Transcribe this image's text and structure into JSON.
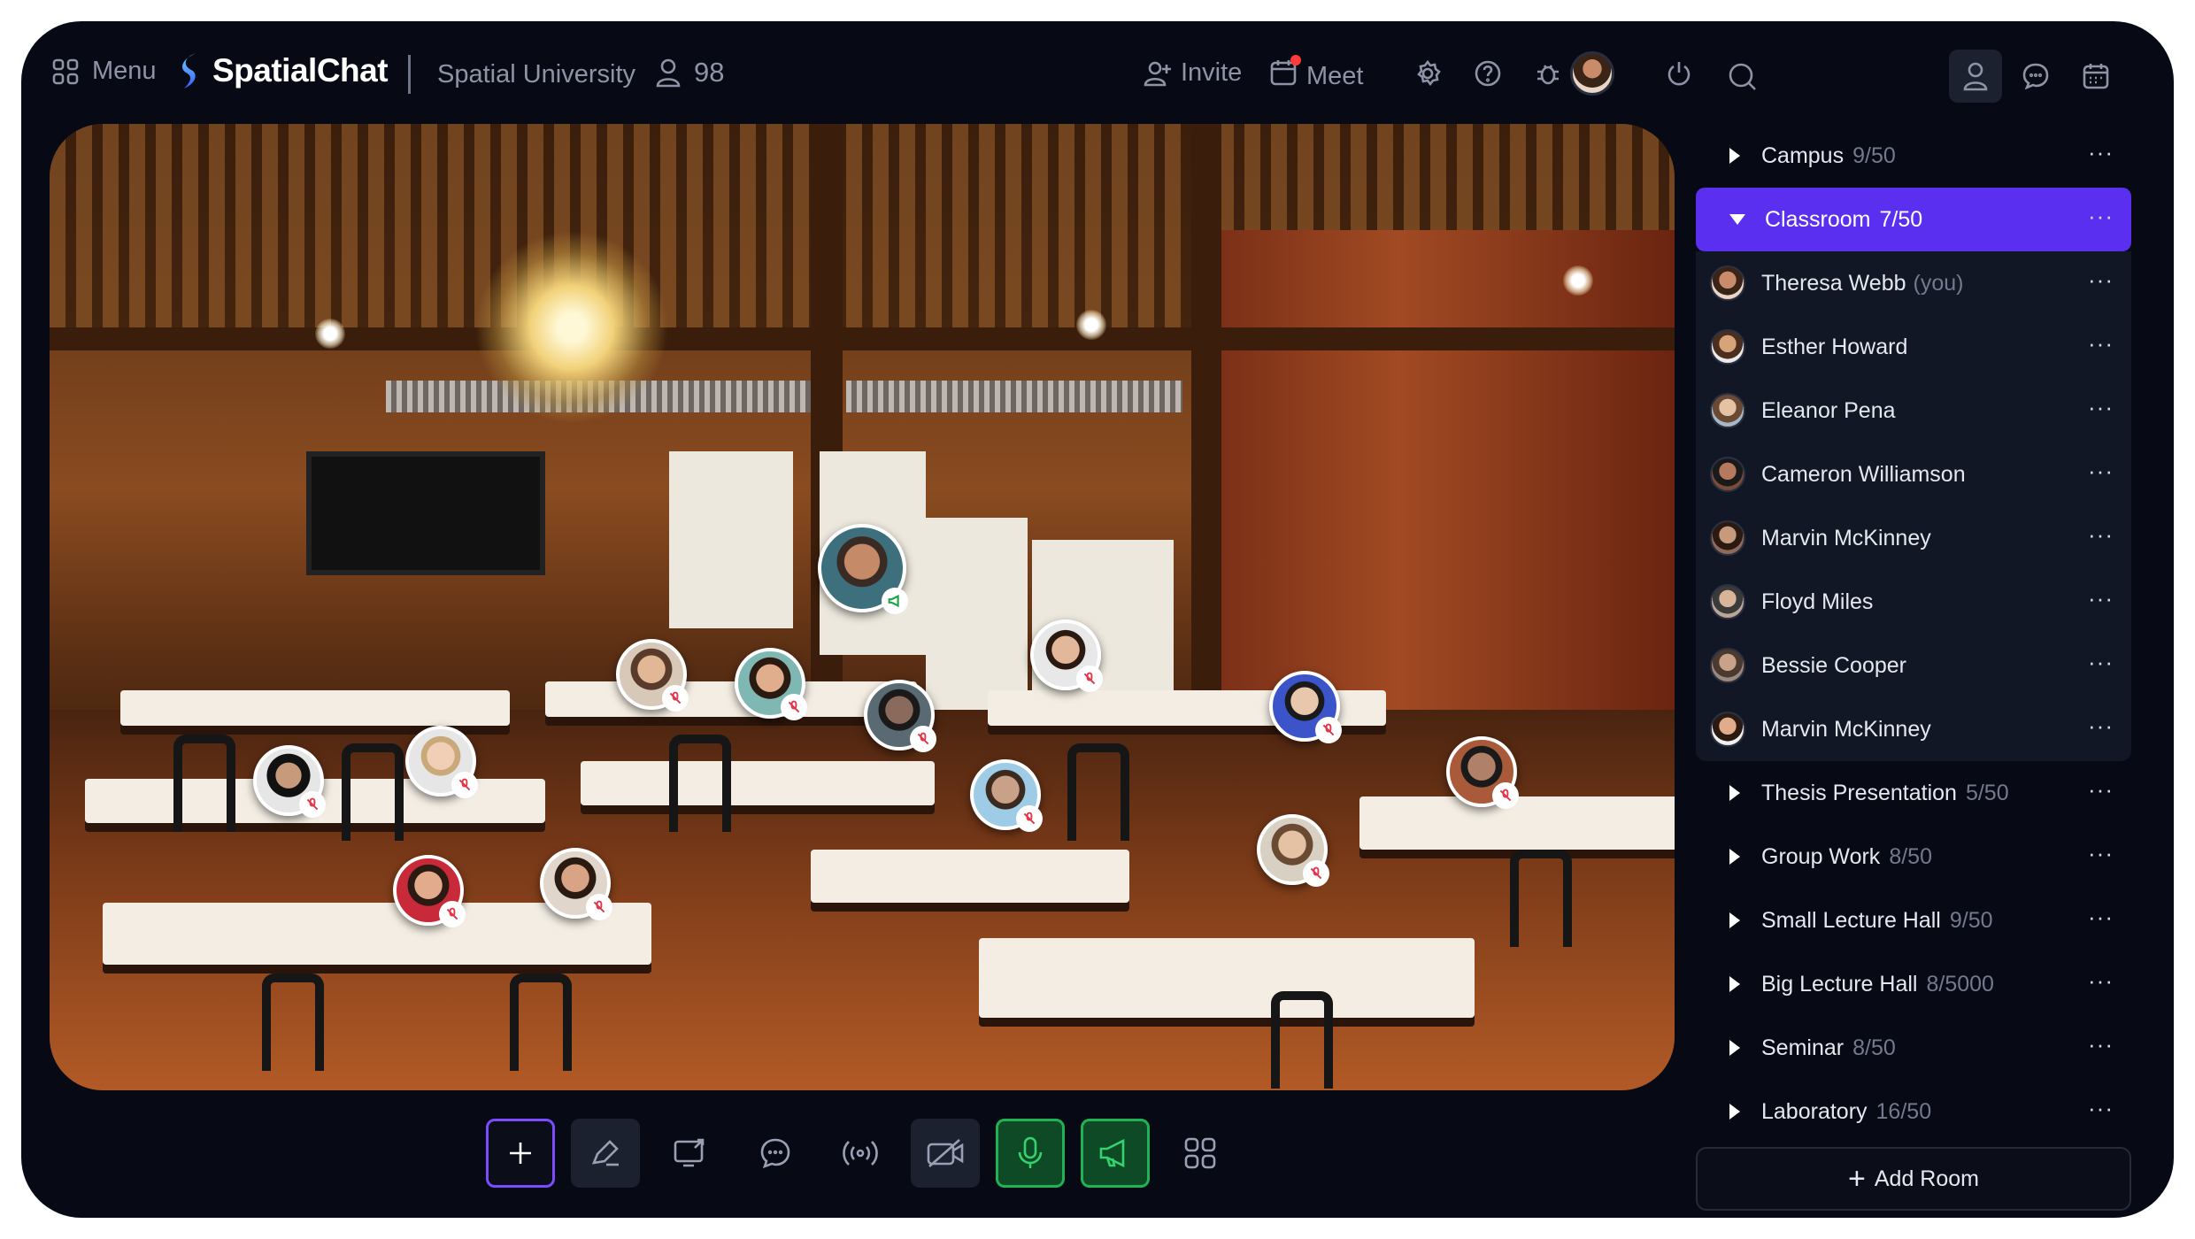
{
  "topbar": {
    "menu_label": "Menu",
    "brand_name": "SpatialChat",
    "org_name": "Spatial University",
    "user_count": "98",
    "invite_label": "Invite",
    "meet_label": "Meet",
    "icons": [
      "grid-icon",
      "user-icon",
      "add-user-icon",
      "calendar-icon",
      "gear-icon",
      "help-icon",
      "bug-icon",
      "power-icon",
      "search-icon",
      "chat-icon"
    ]
  },
  "sidebar": {
    "rooms_before": [
      {
        "name": "Campus",
        "count": "9/50"
      }
    ],
    "active_room": {
      "name": "Classroom",
      "count": "7/50"
    },
    "people": [
      {
        "name": "Theresa Webb",
        "suffix": "(you)",
        "color": "#c98b6a"
      },
      {
        "name": "Esther Howard",
        "suffix": "",
        "color": "#d9a37a"
      },
      {
        "name": "Eleanor Pena",
        "suffix": "",
        "color": "#a8b6c9"
      },
      {
        "name": "Cameron Williamson",
        "suffix": "",
        "color": "#7a4a3a"
      },
      {
        "name": "Marvin McKinney",
        "suffix": "",
        "color": "#8d6a5a"
      },
      {
        "name": "Floyd Miles",
        "suffix": "",
        "color": "#b9a59a"
      },
      {
        "name": "Bessie Cooper",
        "suffix": "",
        "color": "#9a8a7e"
      },
      {
        "name": "Marvin McKinney",
        "suffix": "",
        "color": "#5a3a2e"
      }
    ],
    "rooms_after": [
      {
        "name": "Thesis Presentation",
        "count": "5/50"
      },
      {
        "name": "Group Work",
        "count": "8/50"
      },
      {
        "name": "Small Lecture Hall",
        "count": "9/50"
      },
      {
        "name": "Big Lecture Hall",
        "count": "8/5000"
      },
      {
        "name": "Seminar",
        "count": "8/50"
      },
      {
        "name": "Laboratory",
        "count": "16/50"
      }
    ],
    "add_room_label": "Add Room"
  },
  "colors": {
    "accent": "#5b2ff0",
    "background": "#070a14",
    "panel": "#121726",
    "mic_green": "#1fb356",
    "muted_red": "#e0364a"
  },
  "toolbar": {
    "tools": [
      "add-icon",
      "pen-icon",
      "screen-share-icon",
      "chat-icon",
      "broadcast-icon",
      "camera-off-icon",
      "microphone-icon",
      "megaphone-icon",
      "apps-grid-icon"
    ]
  }
}
